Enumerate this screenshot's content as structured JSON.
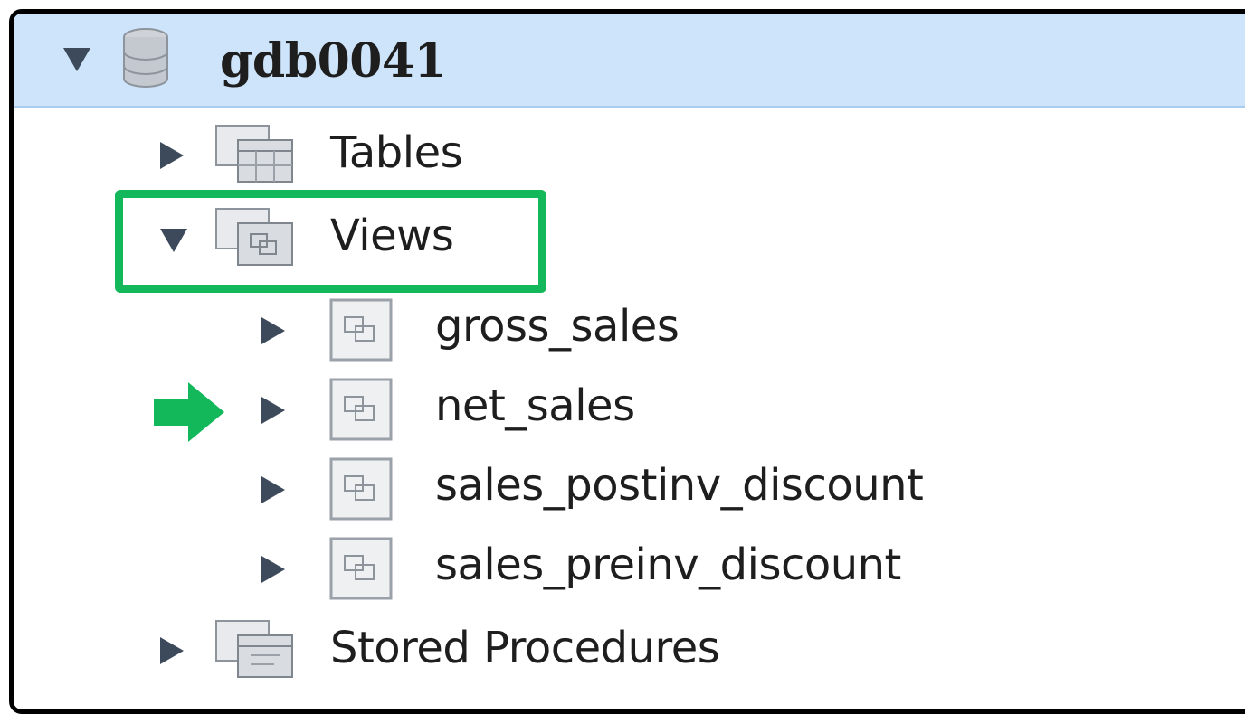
{
  "tree": {
    "root": {
      "label": "gdb0041",
      "icon": "database-icon",
      "expanded": true,
      "selected": true
    },
    "folders": [
      {
        "label": "Tables",
        "icon": "tables-folder-icon",
        "expanded": false
      },
      {
        "label": "Views",
        "icon": "views-folder-icon",
        "expanded": true
      },
      {
        "label": "Stored Procedures",
        "icon": "procedures-folder-icon",
        "expanded": false
      }
    ],
    "views": [
      {
        "label": "gross_sales",
        "icon": "view-icon"
      },
      {
        "label": "net_sales",
        "icon": "view-icon"
      },
      {
        "label": "sales_postinv_discount",
        "icon": "view-icon"
      },
      {
        "label": "sales_preinv_discount",
        "icon": "view-icon"
      }
    ]
  },
  "annotations": {
    "highlight_color": "#12b85a",
    "highlighted_item": "Views",
    "pointed_item": "net_sales"
  },
  "colors": {
    "selection_background": "#cde4fa",
    "toggle_arrow": "#3c4a5c"
  }
}
